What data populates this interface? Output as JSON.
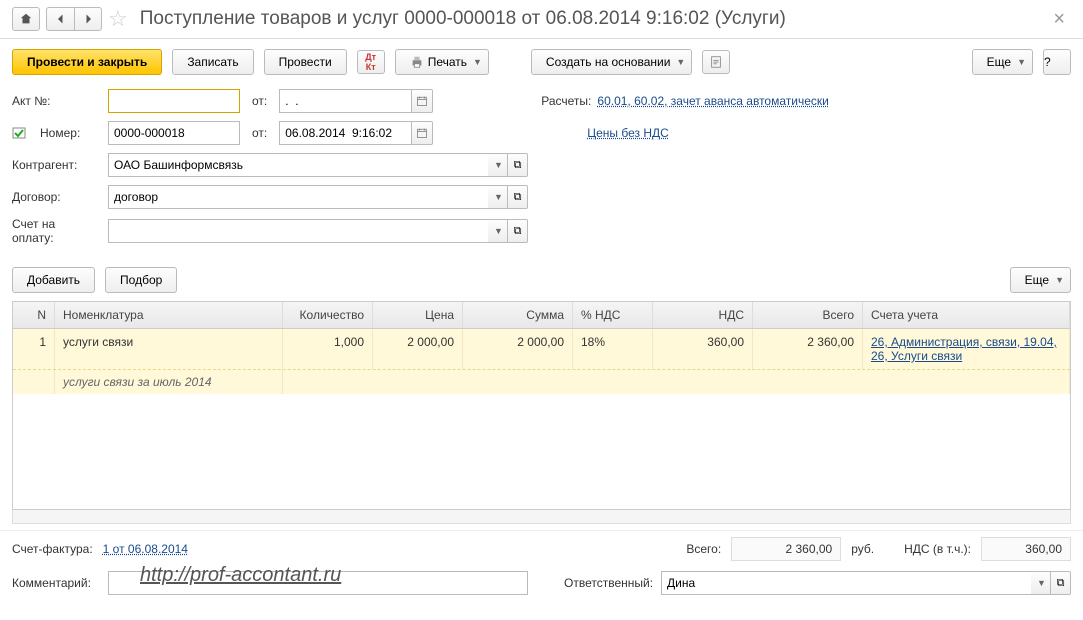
{
  "header": {
    "title": "Поступление товаров и услуг 0000-000018 от 06.08.2014 9:16:02 (Услуги)"
  },
  "toolbar": {
    "post_close": "Провести и закрыть",
    "save": "Записать",
    "post": "Провести",
    "print": "Печать",
    "create_based": "Создать на основании",
    "more": "Еще",
    "help": "?"
  },
  "form": {
    "act_label": "Акт №:",
    "act_value": "",
    "from_label": "от:",
    "act_date": ".  .",
    "calc_label": "Расчеты:",
    "calc_value": "60.01, 60.02, зачет аванса автоматически",
    "number_label": "Номер:",
    "number_value": "0000-000018",
    "doc_date": "06.08.2014  9:16:02",
    "prices_link": "Цены без НДС",
    "contractor_label": "Контрагент:",
    "contractor_value": "ОАО Башинформсвязь",
    "contract_label": "Договор:",
    "contract_value": "договор",
    "invoice_label": "Счет на оплату:",
    "invoice_value": ""
  },
  "table_toolbar": {
    "add": "Добавить",
    "pick": "Подбор",
    "more": "Еще"
  },
  "columns": {
    "n": "N",
    "name": "Номенклатура",
    "qty": "Количество",
    "price": "Цена",
    "sum": "Сумма",
    "vat_pct": "% НДС",
    "vat": "НДС",
    "total": "Всего",
    "accounts": "Счета учета"
  },
  "rows": [
    {
      "n": "1",
      "name": "услуги связи",
      "desc": "услуги связи за июль 2014",
      "qty": "1,000",
      "price": "2 000,00",
      "sum": "2 000,00",
      "vat_pct": "18%",
      "vat": "360,00",
      "total": "2 360,00",
      "accounts": "26, Администрация, связи, 19.04, 26, Услуги связи"
    }
  ],
  "totals": {
    "invoice_label": "Счет-фактура:",
    "invoice_link": "1 от 06.08.2014",
    "total_label": "Всего:",
    "total_value": "2 360,00",
    "currency": "руб.",
    "vat_label": "НДС (в т.ч.):",
    "vat_value": "360,00"
  },
  "footer": {
    "comment_label": "Комментарий:",
    "comment_value": "",
    "responsible_label": "Ответственный:",
    "responsible_value": "Дина",
    "watermark": "http://prof-accontant.ru"
  }
}
